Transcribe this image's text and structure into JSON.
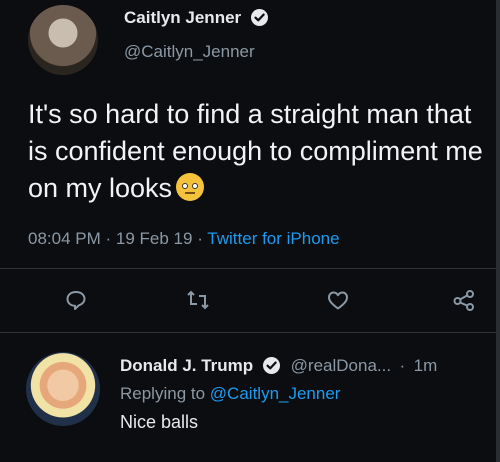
{
  "tweet": {
    "display_name": "Caitlyn Jenner",
    "handle": "@Caitlyn_Jenner",
    "text": "It's so hard to find a straight man that is confident enough to compliment me on my looks",
    "emoji": "face-with-rolling-eyes",
    "time": "08:04 PM",
    "date": "19 Feb 19",
    "separator": "·",
    "source": "Twitter for iPhone"
  },
  "actions": [
    "reply-icon",
    "retweet-icon",
    "like-icon",
    "share-icon"
  ],
  "reply": {
    "display_name": "Donald J. Trump",
    "handle": "@realDona...",
    "separator": "·",
    "age": "1m",
    "replying_label": "Replying to",
    "replying_handle": "@Caitlyn_Jenner",
    "text": "Nice balls"
  },
  "colors": {
    "background": "#0b0d10",
    "accent": "#1d9bf0",
    "muted": "#8b98a5",
    "text": "#e7e9ea"
  }
}
